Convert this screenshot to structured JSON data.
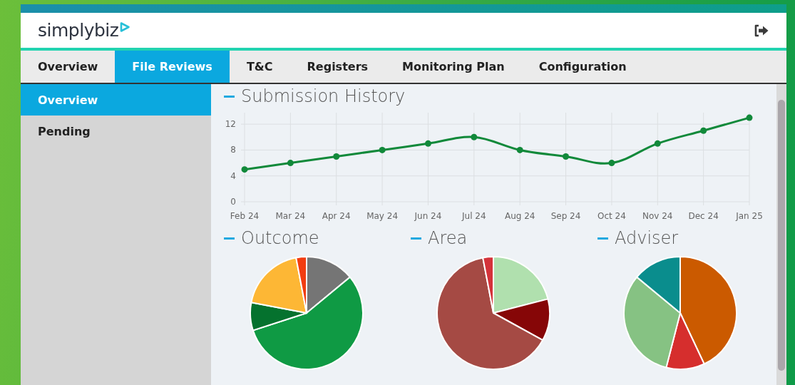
{
  "header": {
    "logo": "simplybiz"
  },
  "tabs": [
    {
      "label": "Overview",
      "selected": false
    },
    {
      "label": "File Reviews",
      "selected": true
    },
    {
      "label": "T&C",
      "selected": false
    },
    {
      "label": "Registers",
      "selected": false
    },
    {
      "label": "Monitoring Plan",
      "selected": false
    },
    {
      "label": "Configuration",
      "selected": false
    }
  ],
  "sidebar": {
    "items": [
      {
        "label": "Overview",
        "selected": true
      },
      {
        "label": "Pending",
        "selected": false
      }
    ]
  },
  "submission_history": {
    "title": "Submission History",
    "chart_data": {
      "type": "line",
      "categories": [
        "Feb 24",
        "Mar 24",
        "Apr 24",
        "May 24",
        "Jun 24",
        "Jul 24",
        "Aug 24",
        "Sep 24",
        "Oct 24",
        "Nov 24",
        "Dec 24",
        "Jan 25"
      ],
      "series": [
        {
          "color": "#11893a",
          "marker": true,
          "values": [
            5,
            6,
            7,
            8,
            9,
            10,
            8,
            7,
            6,
            9,
            11,
            13
          ]
        }
      ],
      "ylim": [
        0,
        14
      ],
      "yticks": [
        0,
        4,
        8,
        12
      ],
      "grid": true
    }
  },
  "panels": [
    {
      "title": "Outcome",
      "kind": "picture"
    },
    {
      "title": "Area",
      "kind": "picture"
    },
    {
      "title": "Adviser",
      "kind": "picture"
    }
  ]
}
